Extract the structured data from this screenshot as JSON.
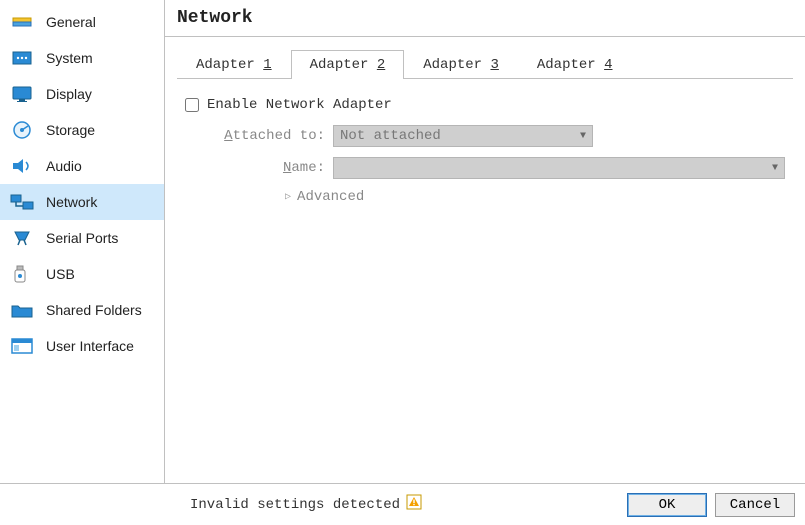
{
  "sidebar": {
    "items": [
      {
        "label": "General"
      },
      {
        "label": "System"
      },
      {
        "label": "Display"
      },
      {
        "label": "Storage"
      },
      {
        "label": "Audio"
      },
      {
        "label": "Network"
      },
      {
        "label": "Serial Ports"
      },
      {
        "label": "USB"
      },
      {
        "label": "Shared Folders"
      },
      {
        "label": "User Interface"
      }
    ],
    "selected_index": 5
  },
  "page": {
    "title": "Network"
  },
  "tabs": {
    "items": [
      {
        "label_prefix": "Adapter ",
        "label_key": "1"
      },
      {
        "label_prefix": "Adapter ",
        "label_key": "2"
      },
      {
        "label_prefix": "Adapter ",
        "label_key": "3"
      },
      {
        "label_prefix": "Adapter ",
        "label_key": "4"
      }
    ],
    "active_index": 1
  },
  "form": {
    "enable_label": "Enable Network Adapter",
    "enable_checked": false,
    "attached_to_label_u": "A",
    "attached_to_label_rest": "ttached to:",
    "attached_to_value": "Not attached",
    "name_label_u": "N",
    "name_label_rest": "ame:",
    "name_value": "",
    "advanced_label_u": "A",
    "advanced_label_rest": "dvanced"
  },
  "footer": {
    "status_text": "Invalid settings detected",
    "ok_label": "OK",
    "cancel_label": "Cancel"
  }
}
